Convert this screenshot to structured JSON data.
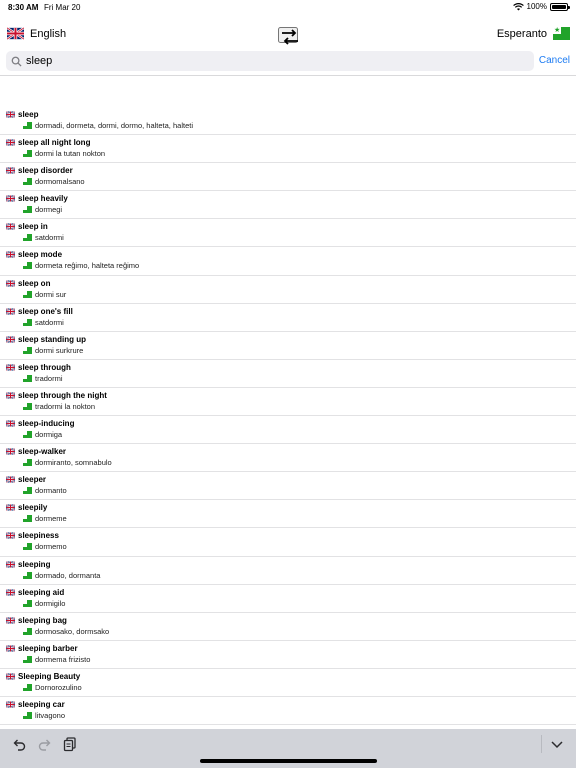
{
  "status": {
    "time": "8:30 AM",
    "date": "Fri Mar 20",
    "battery": "100%"
  },
  "languages": {
    "source": "English",
    "target": "Esperanto"
  },
  "search": {
    "value": "sleep",
    "cancel_label": "Cancel"
  },
  "results": [
    {
      "term": "sleep",
      "translation": "dormadi, dormeta, dormi, dormo, halteta, halteti"
    },
    {
      "term": "sleep all night long",
      "translation": "dormi la tutan nokton"
    },
    {
      "term": "sleep disorder",
      "translation": "dormomalsano"
    },
    {
      "term": "sleep heavily",
      "translation": "dormegi"
    },
    {
      "term": "sleep in",
      "translation": "satdormi"
    },
    {
      "term": "sleep mode",
      "translation": "dormeta reĝimo, halteta reĝimo"
    },
    {
      "term": "sleep on",
      "translation": "dormi sur"
    },
    {
      "term": "sleep one's fill",
      "translation": "satdormi"
    },
    {
      "term": "sleep standing up",
      "translation": "dormi surkrure"
    },
    {
      "term": "sleep through",
      "translation": "tradormi"
    },
    {
      "term": "sleep through the night",
      "translation": "tradormi la nokton"
    },
    {
      "term": "sleep-inducing",
      "translation": "dormiga"
    },
    {
      "term": "sleep-walker",
      "translation": "dormiranto, somnabulo"
    },
    {
      "term": "sleeper",
      "translation": "dormanto"
    },
    {
      "term": "sleepily",
      "translation": "dormeme"
    },
    {
      "term": "sleepiness",
      "translation": "dormemo"
    },
    {
      "term": "sleeping",
      "translation": "dormado, dormanta"
    },
    {
      "term": "sleeping aid",
      "translation": "dormigilo"
    },
    {
      "term": "sleeping bag",
      "translation": "dormosako, dormsako"
    },
    {
      "term": "sleeping barber",
      "translation": "dormema frizisto"
    },
    {
      "term": "Sleeping Beauty",
      "translation": "Dornorozulino"
    },
    {
      "term": "sleeping car",
      "translation": "litvagono"
    }
  ],
  "colors": {
    "accent": "#1e7cf2",
    "esperanto_green": "#21a32a",
    "toolbar": "#d1d3d9"
  },
  "icons": {
    "wifi": "wifi-icon",
    "battery": "battery-icon",
    "swap": "swap-arrows-icon",
    "search": "magnifier-icon",
    "undo": "undo-icon",
    "redo": "redo-icon",
    "paste": "clipboard-icon",
    "dismiss": "chevron-down-icon"
  }
}
